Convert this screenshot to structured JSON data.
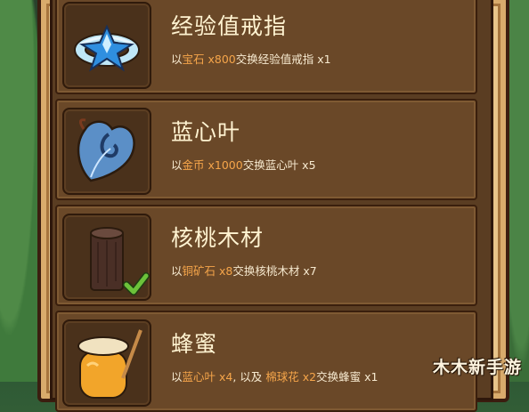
{
  "items": [
    {
      "name": "经验值戒指",
      "icon": "diamond-ring-icon",
      "desc": {
        "prefix": "以",
        "material": "宝石 x800",
        "suffix": "交换经验值戒指 x1"
      },
      "owned_check": false
    },
    {
      "name": "蓝心叶",
      "icon": "blue-heart-leaf-icon",
      "desc": {
        "prefix": "以",
        "material": "金币 x1000",
        "suffix": "交换蓝心叶 x5"
      },
      "owned_check": false
    },
    {
      "name": "核桃木材",
      "icon": "walnut-wood-icon",
      "desc": {
        "prefix": "以",
        "material": "铜矿石 x8",
        "suffix": "交换核桃木材 x7"
      },
      "owned_check": true
    },
    {
      "name": "蜂蜜",
      "icon": "honey-jar-icon",
      "desc": {
        "prefix": "以",
        "material": "蓝心叶 x4",
        "middle": ", 以及 ",
        "material2": "棉球花 x2",
        "suffix": "交换蜂蜜 x1"
      },
      "owned_check": false
    }
  ],
  "watermark": "木木新手游",
  "colors": {
    "highlight": "#f5a54a",
    "panel": "#5a3d22",
    "row": "#6a4828",
    "check": "#6cc23a"
  }
}
